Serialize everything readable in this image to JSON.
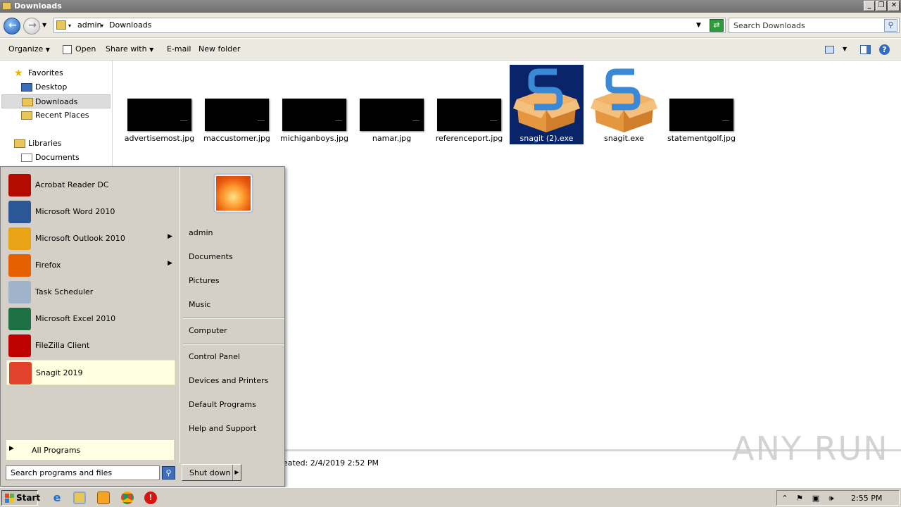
{
  "window": {
    "title": "Downloads"
  },
  "address": {
    "crumbs": [
      "admin",
      "Downloads"
    ],
    "search_placeholder": "Search Downloads"
  },
  "toolbar": {
    "organize": "Organize",
    "open": "Open",
    "share_with": "Share with",
    "email": "E-mail",
    "new_folder": "New folder"
  },
  "nav": {
    "favorites": "Favorites",
    "desktop": "Desktop",
    "downloads": "Downloads",
    "recent_places": "Recent Places",
    "libraries": "Libraries",
    "documents": "Documents"
  },
  "files": [
    {
      "name": "advertisemost.jpg",
      "type": "image"
    },
    {
      "name": "maccustomer.jpg",
      "type": "image"
    },
    {
      "name": "michiganboys.jpg",
      "type": "image"
    },
    {
      "name": "namar.jpg",
      "type": "image"
    },
    {
      "name": "referenceport.jpg",
      "type": "image"
    },
    {
      "name": "snagit (2).exe",
      "type": "installer",
      "selected": true
    },
    {
      "name": "snagit.exe",
      "type": "installer"
    },
    {
      "name": "statementgolf.jpg",
      "type": "image"
    }
  ],
  "details": {
    "created_text": "eated: 2/4/2019 2:52 PM"
  },
  "watermark": "ANY RUN",
  "start_menu": {
    "programs": [
      {
        "label": "Acrobat Reader DC",
        "icon": "acrobat-icon",
        "color": "#b30b00"
      },
      {
        "label": "Microsoft Word 2010",
        "icon": "word-icon",
        "color": "#2b5797"
      },
      {
        "label": "Microsoft Outlook 2010",
        "icon": "outlook-icon",
        "color": "#e8a317",
        "submenu": true
      },
      {
        "label": "Firefox",
        "icon": "firefox-icon",
        "color": "#e66000",
        "submenu": true
      },
      {
        "label": "Task Scheduler",
        "icon": "clock-icon",
        "color": "#9fb4c8"
      },
      {
        "label": "Microsoft Excel 2010",
        "icon": "excel-icon",
        "color": "#1e7145"
      },
      {
        "label": "FileZilla Client",
        "icon": "filezilla-icon",
        "color": "#bf0000"
      },
      {
        "label": "Snagit 2019",
        "icon": "snagit-icon",
        "color": "#e0422c",
        "highlighted": true
      }
    ],
    "all_programs": "All Programs",
    "search_placeholder": "Search programs and files",
    "right": {
      "user": "admin",
      "documents": "Documents",
      "pictures": "Pictures",
      "music": "Music",
      "computer": "Computer",
      "control_panel": "Control Panel",
      "devices_printers": "Devices and Printers",
      "default_programs": "Default Programs",
      "help_support": "Help and Support"
    },
    "shutdown": "Shut down"
  },
  "taskbar": {
    "start": "Start",
    "time": "2:55 PM"
  }
}
